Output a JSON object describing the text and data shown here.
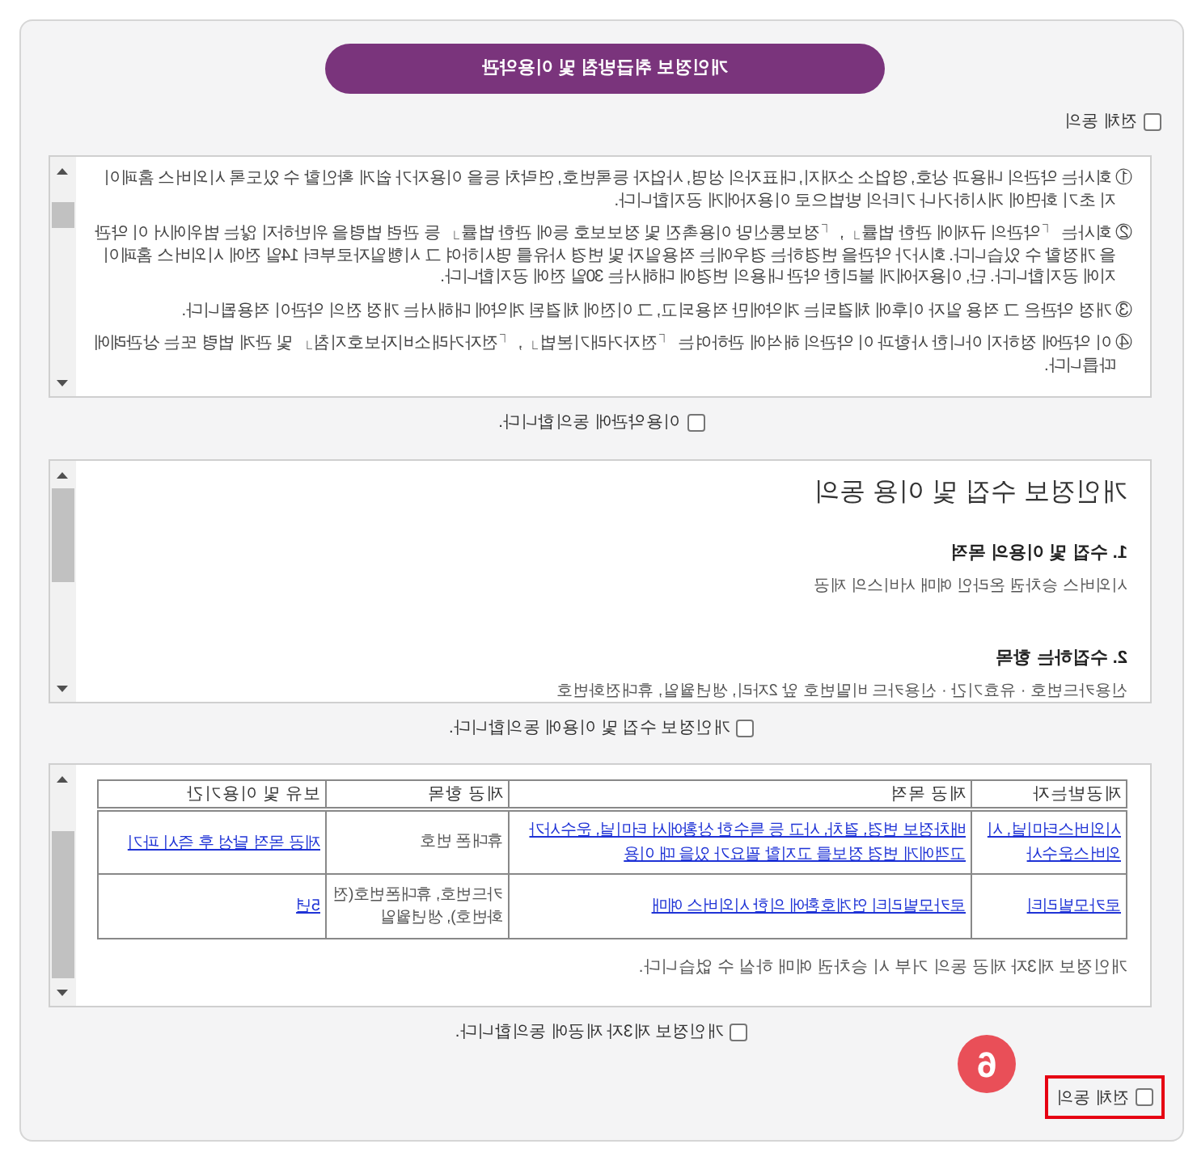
{
  "title": "개인정보 취급방침 및 이용약관",
  "agree_all_top": {
    "label": "전체 동의",
    "checked": false
  },
  "sections": [
    {
      "kind": "terms",
      "paragraphs": [
        "① 회사는 약관의 내용과 상호, 영업소 소재지, 대표자의 성명, 사업자 등록번호, 연락처 등을 이용자가 쉽게 확인할 수 있도록 시외버스 홈페이지 초기 화면에 게시하거나 기타의 방법으로 이용자에게 공지합니다.",
        "② 회사는 「약관의 규제에 관한 법률」, 「정보통신망 이용촉진 및 정보보호 등에 관한 법률」 등 관련 법령을 위반하지 않는 범위에서 이 약관을 개정할 수 있습니다. 회사가 약관을 변경하는 경우에는 적용일자 및 변경 사유를 명시하여 그 시행일자로부터 14일 전에 시외버스 홈페이지에 공지합니다. 단, 이용자에게 불리한 약관 내용의 변경에 대해서는 30일 전에 공지합니다.",
        "③ 개정 약관은 그 적용 일자 이후에 체결되는 계약에만 적용되고, 그 이전에 체결된 계약에 대해서는 개정 전의 약관이 적용됩니다.",
        "④ 이 약관에 정하지 아니한 사항과 이 약관의 해석에 관하여는 「전자거래기본법」, 「전자거래소비자보호지침」 및 관계 법령 또는 상관례에 따릅니다."
      ],
      "agreement": {
        "label": "이용약관에 동의합니다.",
        "checked": false
      }
    },
    {
      "kind": "collection",
      "heading": "개인정보 수집 및 이용 동의",
      "items": [
        {
          "title": "1. 수집 및 이용의 목적",
          "text": "시외버스 승차권 온라인 예매 서비스의 제공"
        },
        {
          "title": "2. 수집하는 항목",
          "text": "신용카드번호 · 유효기간 · 신용카드 비밀번호 앞 2자리, 생년월일, 휴대전화번호"
        }
      ],
      "agreement": {
        "label": "개인정보 수집 및 이용에 동의합니다.",
        "checked": false
      }
    },
    {
      "kind": "third_party",
      "table": {
        "columns": [
          "보유 및 이용기간",
          "제공 항목",
          "제공 목적",
          "제공받는자"
        ],
        "rows": [
          [
            {
              "text": "제공 목적 달성 후 즉시 파기",
              "link": true
            },
            {
              "text": "휴대폰 번호",
              "link": false
            },
            {
              "text": "배차정보 변경, 결차, 사고 등 특수한 상황에서 터미널, 운수사가 고객에게 변경 정보를 고지할 필요가 있을 때 이용",
              "link": true
            },
            {
              "text": "시외버스터미널, 시외버스운수사",
              "link": true
            }
          ],
          [
            {
              "text": "5년",
              "link": true
            },
            {
              "text": "카드번호, 휴대폰번호(전화번호), 생년월일",
              "link": false
            },
            {
              "text": "로카모빌리티 연계호환에 의한 시외버스 예매",
              "link": true
            },
            {
              "text": "로카모빌리티",
              "link": true
            }
          ]
        ]
      },
      "note": "개인정보 제3자 제공 동의 거부 시 승차권 예매 하실 수 없습니다.",
      "agreement": {
        "label": "개인정보 제3자 제공에 동의합니다.",
        "checked": false
      }
    }
  ],
  "agree_all_bottom": {
    "label": "전체 동의",
    "checked": false,
    "highlighted": true,
    "step_badge": "6"
  }
}
